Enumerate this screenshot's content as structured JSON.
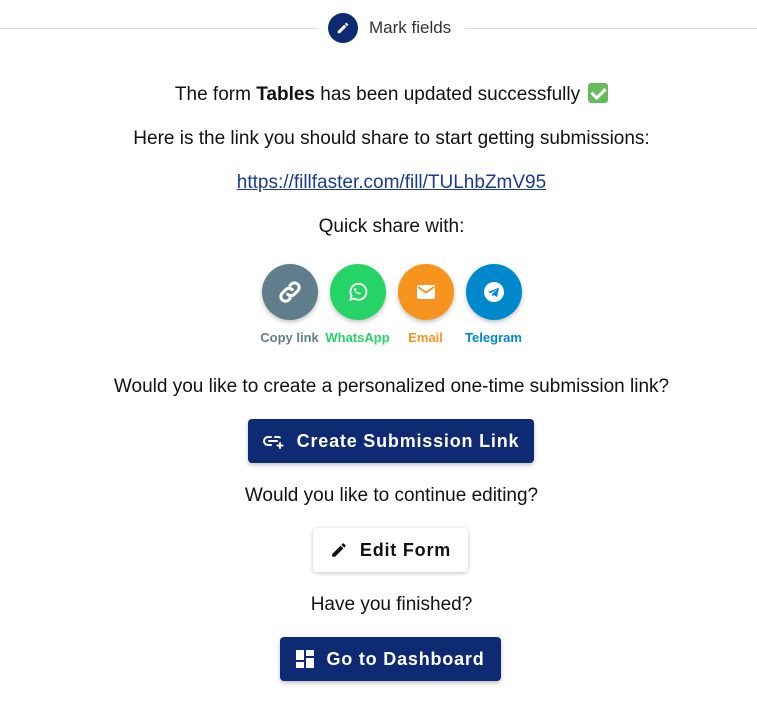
{
  "header": {
    "step_label": "Mark fields",
    "step_icon": "pencil-icon"
  },
  "main": {
    "success_prefix": "The form ",
    "form_name": "Tables",
    "success_suffix": " has been updated successfully",
    "share_prompt": "Here is the link you should share to start getting submissions:",
    "share_url": "https://fillfaster.com/fill/TULhbZmV95",
    "quick_share_label": "Quick share with:",
    "personalized_prompt": "Would you like to create a personalized one-time submission link?",
    "continue_prompt": "Would you like to continue editing?",
    "finished_prompt": "Have you finished?"
  },
  "share_options": [
    {
      "label": "Copy link",
      "icon": "link-icon",
      "color": "#607d8b"
    },
    {
      "label": "WhatsApp",
      "icon": "whatsapp-icon",
      "color": "#25d366"
    },
    {
      "label": "Email",
      "icon": "email-icon",
      "color": "#f7941d"
    },
    {
      "label": "Telegram",
      "icon": "telegram-icon",
      "color": "#0088cc"
    }
  ],
  "buttons": {
    "create_link": "Create Submission Link",
    "edit_form": "Edit Form",
    "dashboard": "Go to Dashboard"
  },
  "colors": {
    "primary": "#0d2a73",
    "success_check": "#66bb5a"
  }
}
